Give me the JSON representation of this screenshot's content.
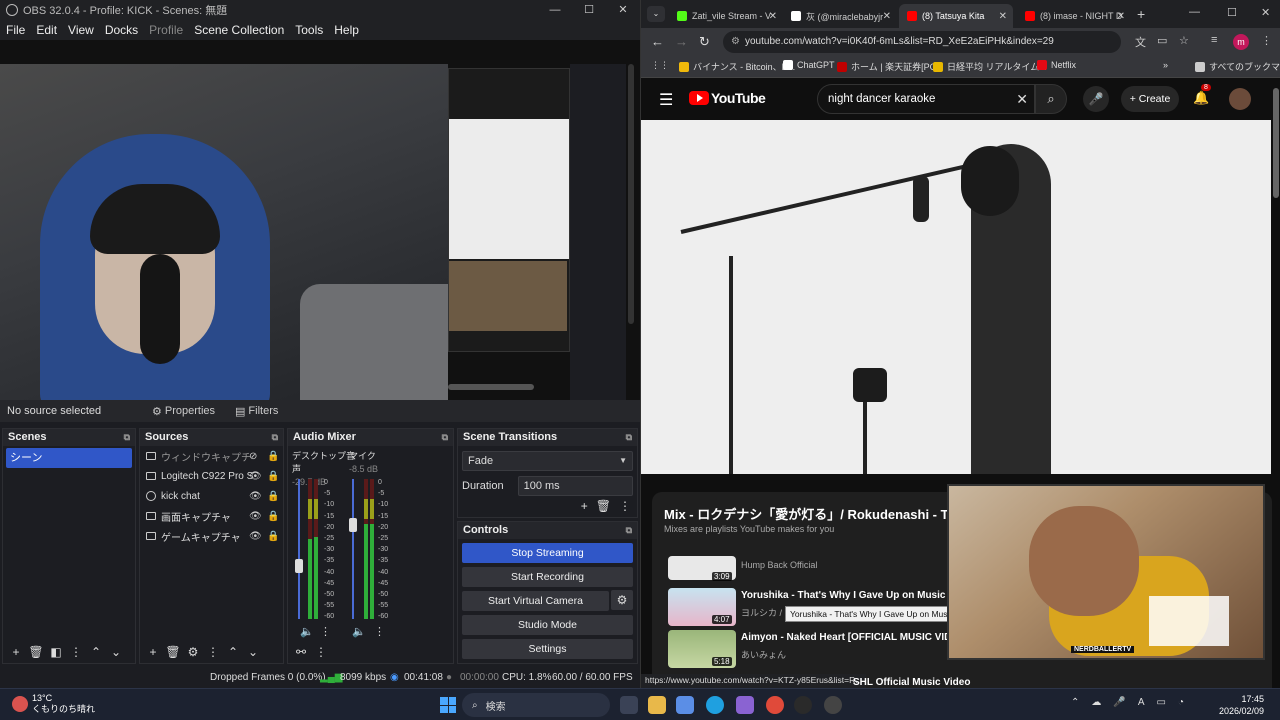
{
  "obs": {
    "title": "OBS 32.0.4 - Profile: KICK - Scenes: 無題",
    "menu": [
      "File",
      "Edit",
      "View",
      "Docks",
      "Profile",
      "Scene Collection",
      "Tools",
      "Help"
    ],
    "source_bar": {
      "selection": "No source selected",
      "properties": "Properties",
      "filters": "Filters"
    },
    "scenes": {
      "header": "Scenes",
      "items": [
        "シーン"
      ]
    },
    "sources": {
      "header": "Sources",
      "items": [
        {
          "label": "ウィンドウキャプチャ"
        },
        {
          "label": "Logitech C922 Pro Str"
        },
        {
          "label": "kick chat"
        },
        {
          "label": "画面キャプチャ"
        },
        {
          "label": "ゲームキャプチャ"
        }
      ]
    },
    "mixer": {
      "header": "Audio Mixer",
      "channels": [
        {
          "name": "デスクトップ音声",
          "db": "-29.7 dB"
        },
        {
          "name": "マイク",
          "db": "-8.5 dB"
        }
      ],
      "ticks": [
        "0",
        "-5",
        "-10",
        "-15",
        "-20",
        "-25",
        "-30",
        "-35",
        "-40",
        "-45",
        "-50",
        "-55",
        "-60"
      ]
    },
    "transitions": {
      "header": "Scene Transitions",
      "type": "Fade",
      "duration_label": "Duration",
      "duration": "100 ms"
    },
    "controls": {
      "header": "Controls",
      "stop_streaming": "Stop Streaming",
      "start_recording": "Start Recording",
      "start_virtual_camera": "Start Virtual Camera",
      "studio_mode": "Studio Mode",
      "settings": "Settings"
    },
    "status": {
      "dropped": "Dropped Frames 0 (0.0%)",
      "bitrate": "8099 kbps",
      "stream_time": "00:41:08",
      "rec_time": "00:00:00",
      "cpu": "CPU: 1.8%",
      "fps": "60.00 / 60.00 FPS"
    }
  },
  "chrome": {
    "tabs": [
      {
        "label": "Zati_vile Stream - V",
        "color": "#53fc18"
      },
      {
        "label": "灰 (@miraclebabyjr",
        "color": "#ffffff"
      },
      {
        "label": "(8) Tatsuya Kita",
        "color": "#ff0000"
      },
      {
        "label": "(8) imase - NIGHT D",
        "color": "#ff0000"
      }
    ],
    "url": "youtube.com/watch?v=i0K40f-6mLs&list=RD_XeE2aEiPHk&index=29",
    "bookmarks": [
      {
        "label": "バイナンス - Bitcoin、E...",
        "color": "#f0b90b"
      },
      {
        "label": "ChatGPT",
        "color": "#ffffff"
      },
      {
        "label": "ホーム | 楽天証券[PC]",
        "color": "#bf0000"
      },
      {
        "label": "日経平均 リアルタイム...",
        "color": "#e8b800"
      },
      {
        "label": "Netflix",
        "color": "#e50914"
      },
      {
        "label": "すべてのブックマーク",
        "color": "#cccccc"
      }
    ],
    "profile_initial": "m"
  },
  "youtube": {
    "logo": "YouTube",
    "search_value": "night dancer karaoke",
    "create": "Create",
    "notifications": "8",
    "playlist": {
      "title": "Mix - ロクデナシ「愛が灯る」/ Rokudenashi - Th",
      "subtitle": "Mixes are playlists YouTube makes for you",
      "items": [
        {
          "title": "",
          "artist": "Hump Back Official",
          "duration": "3:09"
        },
        {
          "title": "Yorushika - That's Why I Gave Up on Music (MUSIC",
          "artist": "ヨルシカ /",
          "duration": "4:07"
        },
        {
          "title": "Aimyon - Naked Heart [OFFICIAL MUSIC VIDEO]",
          "artist": "あいみょん",
          "duration": "5:18"
        }
      ]
    },
    "tooltip": "Yorushika - That's Why I Gave Up on Music (MUSIC VIDEO)",
    "hover_url": "https://www.youtube.com/watch?v=KTZ-y85Erus&list=R...",
    "footer_text": "SHL  Official Music Video",
    "pip_tag": "NERDBALLERTV"
  },
  "taskbar": {
    "weather_temp": "13°C",
    "weather_desc": "くもりのち晴れ",
    "search": "検索",
    "time": "17:45",
    "date": "2026/02/09"
  }
}
